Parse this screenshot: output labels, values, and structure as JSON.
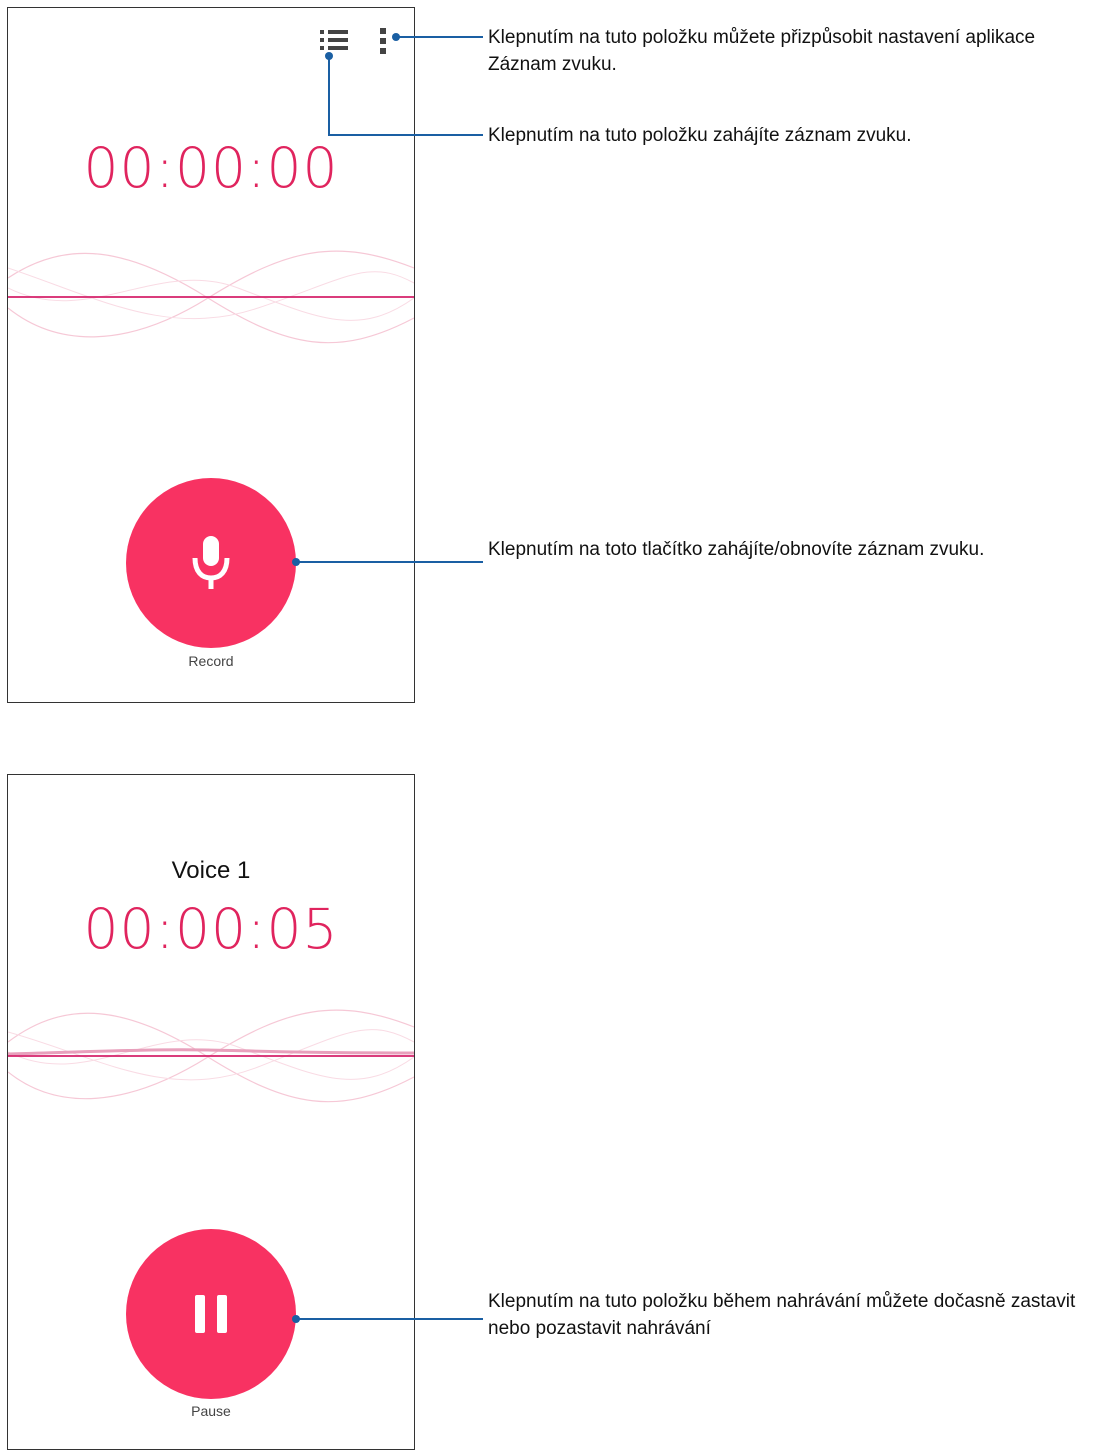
{
  "screen1": {
    "timer": "00:00:00",
    "record_label": "Record",
    "icons": {
      "list": "list-icon",
      "menu": "more-vert-icon",
      "record": "microphone-icon"
    }
  },
  "screen2": {
    "voice_title": "Voice 1",
    "timer": "00:00:05",
    "pause_label": "Pause",
    "icons": {
      "pause": "pause-icon"
    }
  },
  "callouts": {
    "settings": "Klepnutím na tuto položku můžete přizpůsobit nastavení aplikace Záznam zvuku.",
    "list": "Klepnutím na tuto položku zahájíte záznam zvuku.",
    "record": "Klepnutím na toto tlačítko zahájíte/obnovíte záznam zvuku.",
    "pause": "Klepnutím na tuto položku během nahrávání můžete dočasně zastavit nebo pozastavit nahrávání"
  },
  "colors": {
    "accent": "#f83262",
    "timer": "#e0245e",
    "callout_line": "#1a5fa3"
  }
}
